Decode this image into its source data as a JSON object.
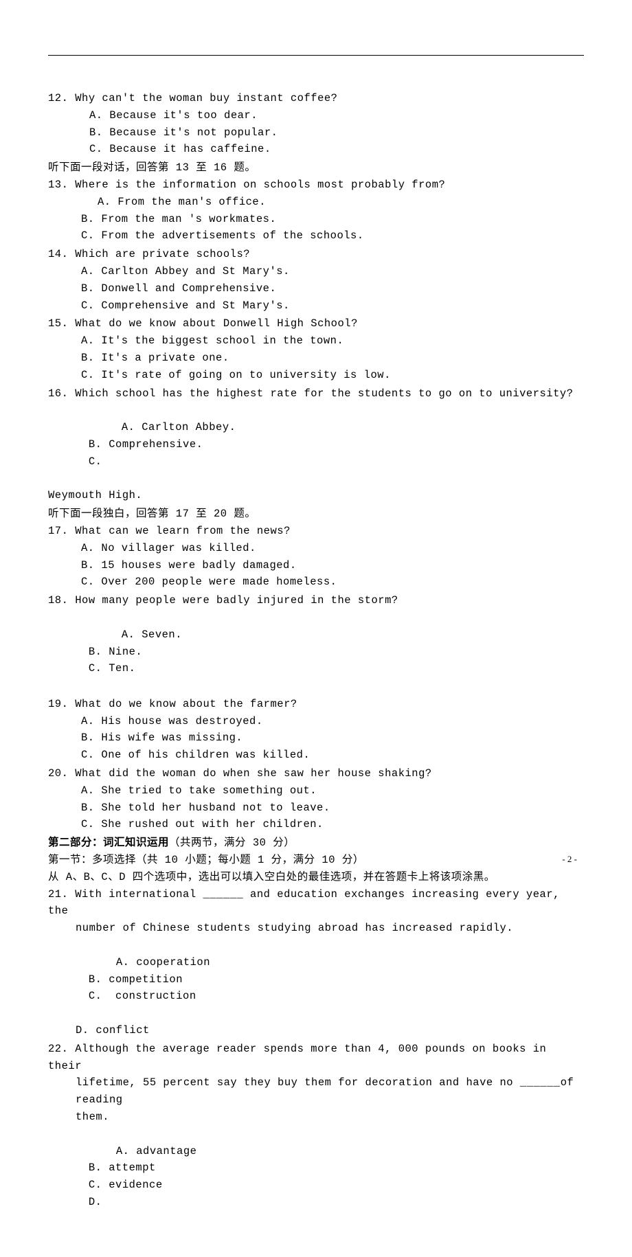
{
  "q12": {
    "num": "12.",
    "text": "Why can't the woman buy instant coffee?",
    "a": "A. Because it's too dear.",
    "b": "B. Because it's not popular.",
    "c": "C. Because it has caffeine."
  },
  "intro13": "听下面一段对话，回答第 13 至 16 题。",
  "q13": {
    "num": "13.",
    "text": "Where is the information on schools most probably from?",
    "a": "A. From the man's office.",
    "b": "B. From the man 's workmates.",
    "c": "C. From the advertisements of the schools."
  },
  "q14": {
    "num": "14.",
    "text": "Which are private schools?",
    "a": "A. Carlton Abbey and St Mary's.",
    "b": "B. Donwell and Comprehensive.",
    "c": "C. Comprehensive and St Mary's."
  },
  "q15": {
    "num": "15.",
    "text": "What do we know about Donwell High School?",
    "a": "A. It's the biggest school in the town.",
    "b": "B. It's a private one.",
    "c": "C. It's rate of going on to university is low."
  },
  "q16": {
    "num": "16.",
    "text": "Which school has the highest rate for the students to go on to university?",
    "a": "A. Carlton Abbey.",
    "b": "B. Comprehensive.",
    "c": "C.",
    "c_text": "Weymouth High."
  },
  "intro17": "听下面一段独白，回答第 17 至 20 题。",
  "q17": {
    "num": "17.",
    "text": "What can we learn from the news?",
    "a": "A. No villager was killed.",
    "b": "B. 15 houses were badly damaged.",
    "c": "C. Over 200 people were made homeless."
  },
  "q18": {
    "num": "18.",
    "text": "How many people were badly injured in the storm?",
    "a": "A. Seven.",
    "b": "B. Nine.",
    "c": "C. Ten."
  },
  "q19": {
    "num": "19.",
    "text": "What do we know about the farmer?",
    "a": "A. His house was destroyed.",
    "b": "B. His wife was missing.",
    "c": "C. One of his children was killed."
  },
  "q20": {
    "num": "20.",
    "text": "What did the woman do when she saw her house shaking?",
    "a": "A. She tried to take something out.",
    "b": "B.  She told her husband not to leave.",
    "c": "C. She rushed out with her children."
  },
  "section2": {
    "title": "第二部分：词汇知识运用",
    "title_paren": "（共两节，满分 30 分）",
    "sub1": "第一节：多项选择（共 10 小题；每小题 1 分，满分 10 分）",
    "instr": "从 A、B、C、D 四个选项中，选出可以填入空白处的最佳选项，并在答题卡上将该项涂黑。"
  },
  "q21": {
    "num": "21.",
    "line1": "With international ______ and education exchanges increasing every year, the",
    "line2": "number of Chinese students studying abroad has increased rapidly.",
    "a": "A. cooperation",
    "b": "B. competition",
    "c": "C.  construction",
    "d": "D. conflict"
  },
  "q22": {
    "num": "22.",
    "line1": "Although the average reader spends more than 4, 000 pounds on books in their",
    "line2": "lifetime, 55 percent say they buy them for decoration and have no ______of reading",
    "line3": "them.",
    "a": "A. advantage",
    "b": "B. attempt",
    "c": "C. evidence",
    "d": "D."
  },
  "footer": "- 2 -"
}
